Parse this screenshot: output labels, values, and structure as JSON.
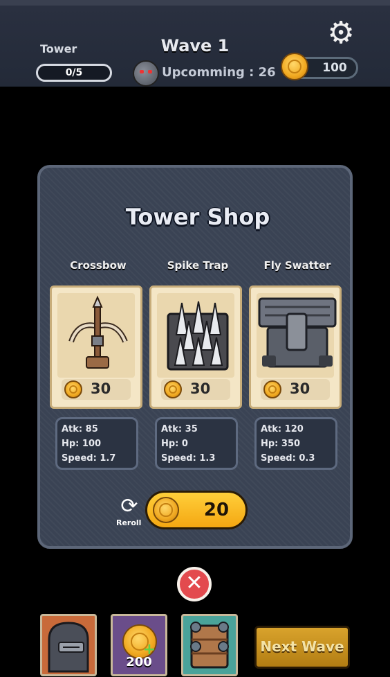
{
  "hud": {
    "tower_label": "Tower",
    "tower_count": "0/5",
    "wave_title": "Wave 1",
    "upcoming": "Upcomming : 26",
    "coins": "100"
  },
  "shop": {
    "title": "Tower Shop",
    "towers": [
      {
        "name": "Crossbow",
        "price": "30",
        "atk": "Atk: 85",
        "hp": "Hp: 100",
        "speed": "Speed: 1.7"
      },
      {
        "name": "Spike Trap",
        "price": "30",
        "atk": "Atk: 35",
        "hp": "Hp: 0",
        "speed": "Speed: 1.3"
      },
      {
        "name": "Fly Swatter",
        "price": "30",
        "atk": "Atk: 120",
        "hp": "Hp: 350",
        "speed": "Speed: 0.3"
      }
    ],
    "reroll_label": "Reroll",
    "reroll_cost": "20"
  },
  "bottom": {
    "coin_bonus": "200",
    "next_wave": "Next Wave"
  },
  "colors": {
    "accent_gold": "#f4a712",
    "close_red": "#e34a4e",
    "panel": "#3a4354"
  }
}
